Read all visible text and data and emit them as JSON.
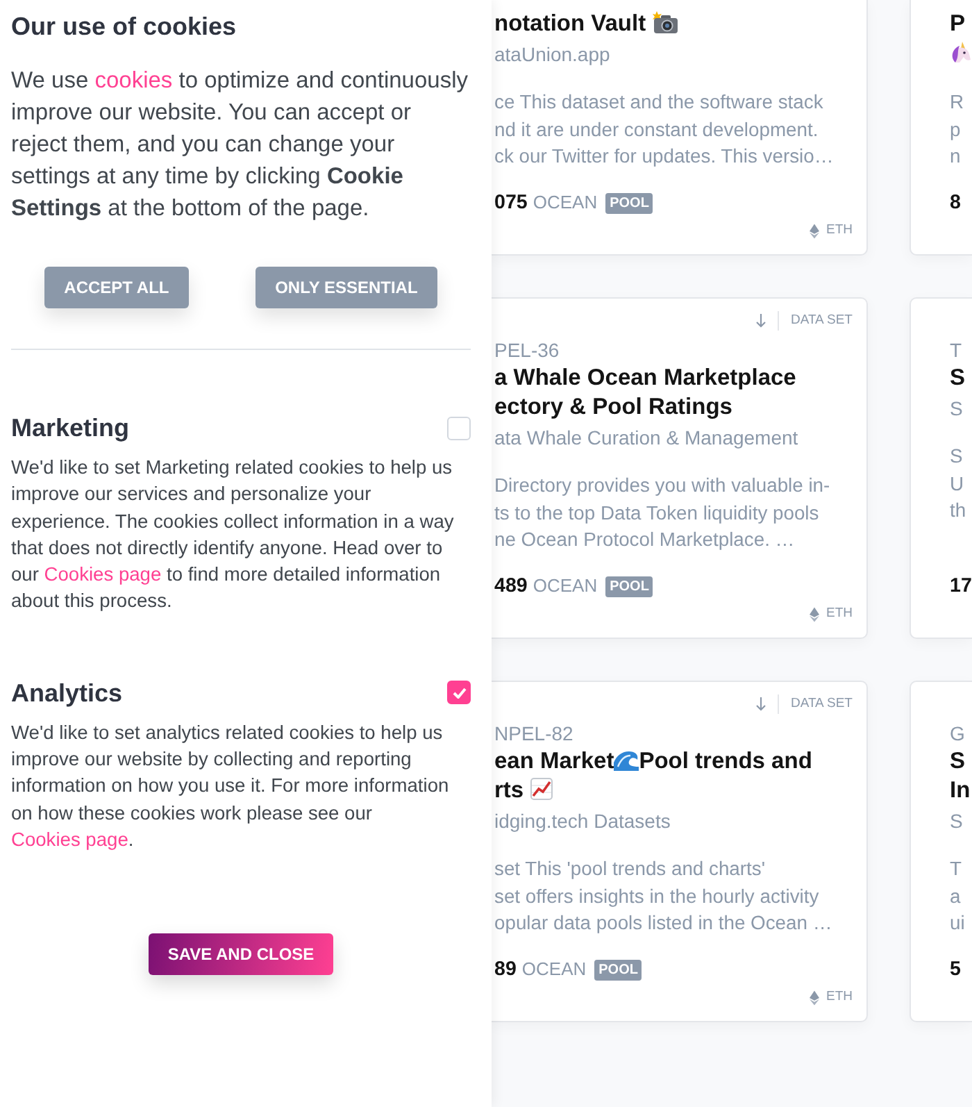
{
  "cookie_panel": {
    "title": "Our use of cookies",
    "intro": [
      {
        "kind": "text",
        "text": "We use "
      },
      {
        "kind": "link",
        "text": "cookies"
      },
      {
        "kind": "text",
        "text": " to optimize and continuously improve our website. You can accept or reject them, and you can change your settings at any time by clicking **Cookie Settings** at the bottom of the page."
      }
    ],
    "buttons": [
      "ACCEPT ALL",
      "ONLY ESSENTIAL"
    ],
    "sections": [
      {
        "title": "Marketing",
        "checked": false,
        "text": [
          {
            "kind": "text",
            "text": "We'd like to set Marketing related cookies to help us improve our services and personalize your experience. The cookies collect information in a way that does not directly identify anyone. Head over to our "
          },
          {
            "kind": "link",
            "text": "Cookies page"
          },
          {
            "kind": "text",
            "text": " to find more detailed information about this process."
          }
        ]
      },
      {
        "title": "Analytics",
        "checked": true,
        "text": [
          {
            "kind": "text",
            "text": "We'd like to set analytics related cookies to help us improve our website by collecting and reporting information on how you use it. For more information on how these cookies work please see our "
          },
          {
            "kind": "link",
            "text": "Cookies page"
          },
          {
            "kind": "text",
            "text": "."
          }
        ]
      }
    ],
    "save_button": "SAVE AND CLOSE"
  },
  "cards": [
    {
      "title_lines": [
        [
          {
            "kind": "text",
            "text": "notation Vault "
          },
          {
            "kind": "camera"
          }
        ]
      ],
      "subtitle": [
        {
          "kind": "text",
          "text": "ataUnion.app"
        }
      ],
      "description_lines": [
        "ce This dataset and the software stack",
        "nd it are under constant development.",
        "ck our Twitter for updates. This versio…"
      ],
      "price": "075",
      "currency": "OCEAN",
      "badge": "POOL",
      "network": "ETH"
    },
    {
      "title_lines": [
        [
          {
            "kind": "text",
            "text": "P"
          }
        ]
      ],
      "subtitle": [
        {
          "kind": "unicorn"
        }
      ],
      "description_lines": [
        "R",
        "p",
        "n"
      ],
      "price": "8"
    },
    {
      "type_label": "DATA SET",
      "symbol": "PEL-36",
      "title_lines": [
        [
          {
            "kind": "text",
            "text": "a Whale Ocean Marketplace"
          }
        ],
        [
          {
            "kind": "text",
            "text": "ectory & Pool Ratings"
          }
        ]
      ],
      "subtitle": [
        {
          "kind": "text",
          "text": "ata Whale Curation & Management"
        }
      ],
      "description_lines": [
        "Directory provides you with valuable in-",
        "ts to the top Data Token liquidity pools",
        "ne Ocean Protocol Marketplace. …"
      ],
      "price": "489",
      "currency": "OCEAN",
      "badge": "POOL",
      "network": "ETH"
    },
    {
      "symbol": "T",
      "title_lines": [
        [
          {
            "kind": "text",
            "text": "S"
          }
        ]
      ],
      "subtitle": [
        {
          "kind": "text",
          "text": "S"
        }
      ],
      "description_lines": [
        "S",
        "U",
        "th"
      ],
      "price": "17"
    },
    {
      "type_label": "DATA SET",
      "symbol": "NPEL-82",
      "title_lines": [
        [
          {
            "kind": "text",
            "text": "ean Market"
          },
          {
            "kind": "wave"
          },
          {
            "kind": "text",
            "text": "Pool trends and"
          }
        ],
        [
          {
            "kind": "text",
            "text": "rts "
          },
          {
            "kind": "chart"
          }
        ]
      ],
      "subtitle": [
        {
          "kind": "text",
          "text": "idging.tech Datasets"
        }
      ],
      "description_lines": [
        "set This 'pool trends and charts'",
        "set offers insights in the hourly activity",
        "opular data pools listed in the Ocean …"
      ],
      "price": "89",
      "currency": "OCEAN",
      "badge": "POOL",
      "network": "ETH"
    },
    {
      "symbol": "G",
      "title_lines": [
        [
          {
            "kind": "text",
            "text": "S"
          }
        ],
        [
          {
            "kind": "text",
            "text": "In"
          }
        ]
      ],
      "subtitle": [
        {
          "kind": "text",
          "text": "S"
        }
      ],
      "description_lines": [
        "T",
        "a",
        "ui"
      ],
      "price": "5"
    }
  ]
}
